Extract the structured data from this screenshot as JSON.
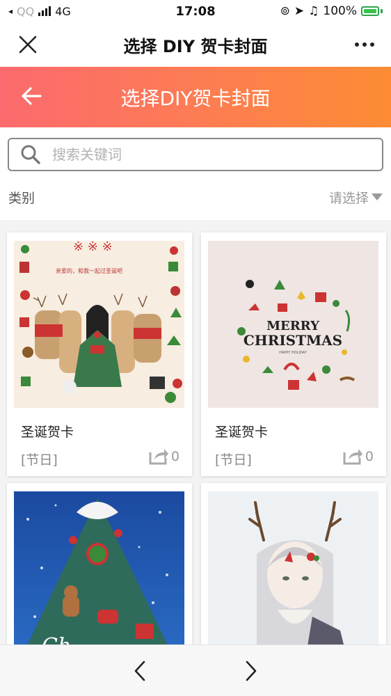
{
  "status_bar": {
    "carrier": "QQ",
    "network": "4G",
    "time": "17:08",
    "battery": "100%"
  },
  "nav_bar": {
    "title": "选择 DIY 贺卡封面",
    "close_icon": "close-icon",
    "more_icon": "more-dots-icon"
  },
  "header": {
    "title": "选择DIY贺卡封面",
    "back_icon": "arrow-left-icon",
    "gradient": [
      "#fb6a6e",
      "#fd8c34"
    ]
  },
  "search": {
    "placeholder": "搜索关键词",
    "value": ""
  },
  "filter": {
    "label": "类别",
    "select_value": "请选择"
  },
  "cards": [
    {
      "title": "圣诞贺卡",
      "tag": "[节日]",
      "share_count": "0",
      "image": "christmas-girl-reindeer-illustration"
    },
    {
      "title": "圣诞贺卡",
      "tag": "[节日]",
      "share_count": "0",
      "image": "merry-christmas-wreath-illustration"
    },
    {
      "title": "",
      "tag": "",
      "share_count": "",
      "image": "christmas-tree-snow-illustration"
    },
    {
      "title": "",
      "tag": "",
      "share_count": "",
      "image": "deer-girl-illustration"
    }
  ],
  "artwork_text": {
    "card2_line1": "MERRY",
    "card2_line2": "CHRISTMAS",
    "card2_small": "HAPPY HOLIDAY"
  },
  "bottom_bar": {
    "prev_icon": "chevron-left-icon",
    "next_icon": "chevron-right-icon"
  },
  "colors": {
    "accent_start": "#fb6a6e",
    "accent_end": "#fd8c34",
    "battery_green": "#37c24a"
  }
}
